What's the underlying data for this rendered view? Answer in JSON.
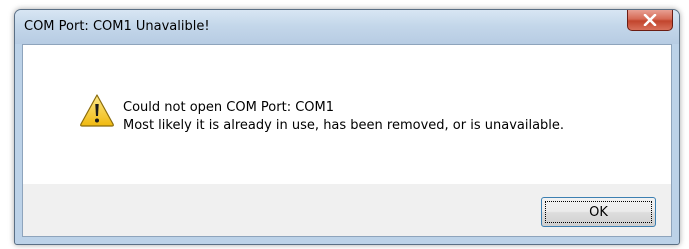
{
  "window": {
    "title": "COM Port: COM1 Unavalible!"
  },
  "message": {
    "line1": "Could not open COM Port: COM1",
    "line2": "Most likely it is already in use, has been removed, or is unavailable."
  },
  "buttons": {
    "ok_label": "OK"
  },
  "icons": {
    "message_icon": "warning-icon",
    "close_icon": "close-icon"
  },
  "colors": {
    "warning_yellow": "#f3c623",
    "close_red": "#c2452d",
    "titlebar_blue": "#c4d7ea"
  }
}
